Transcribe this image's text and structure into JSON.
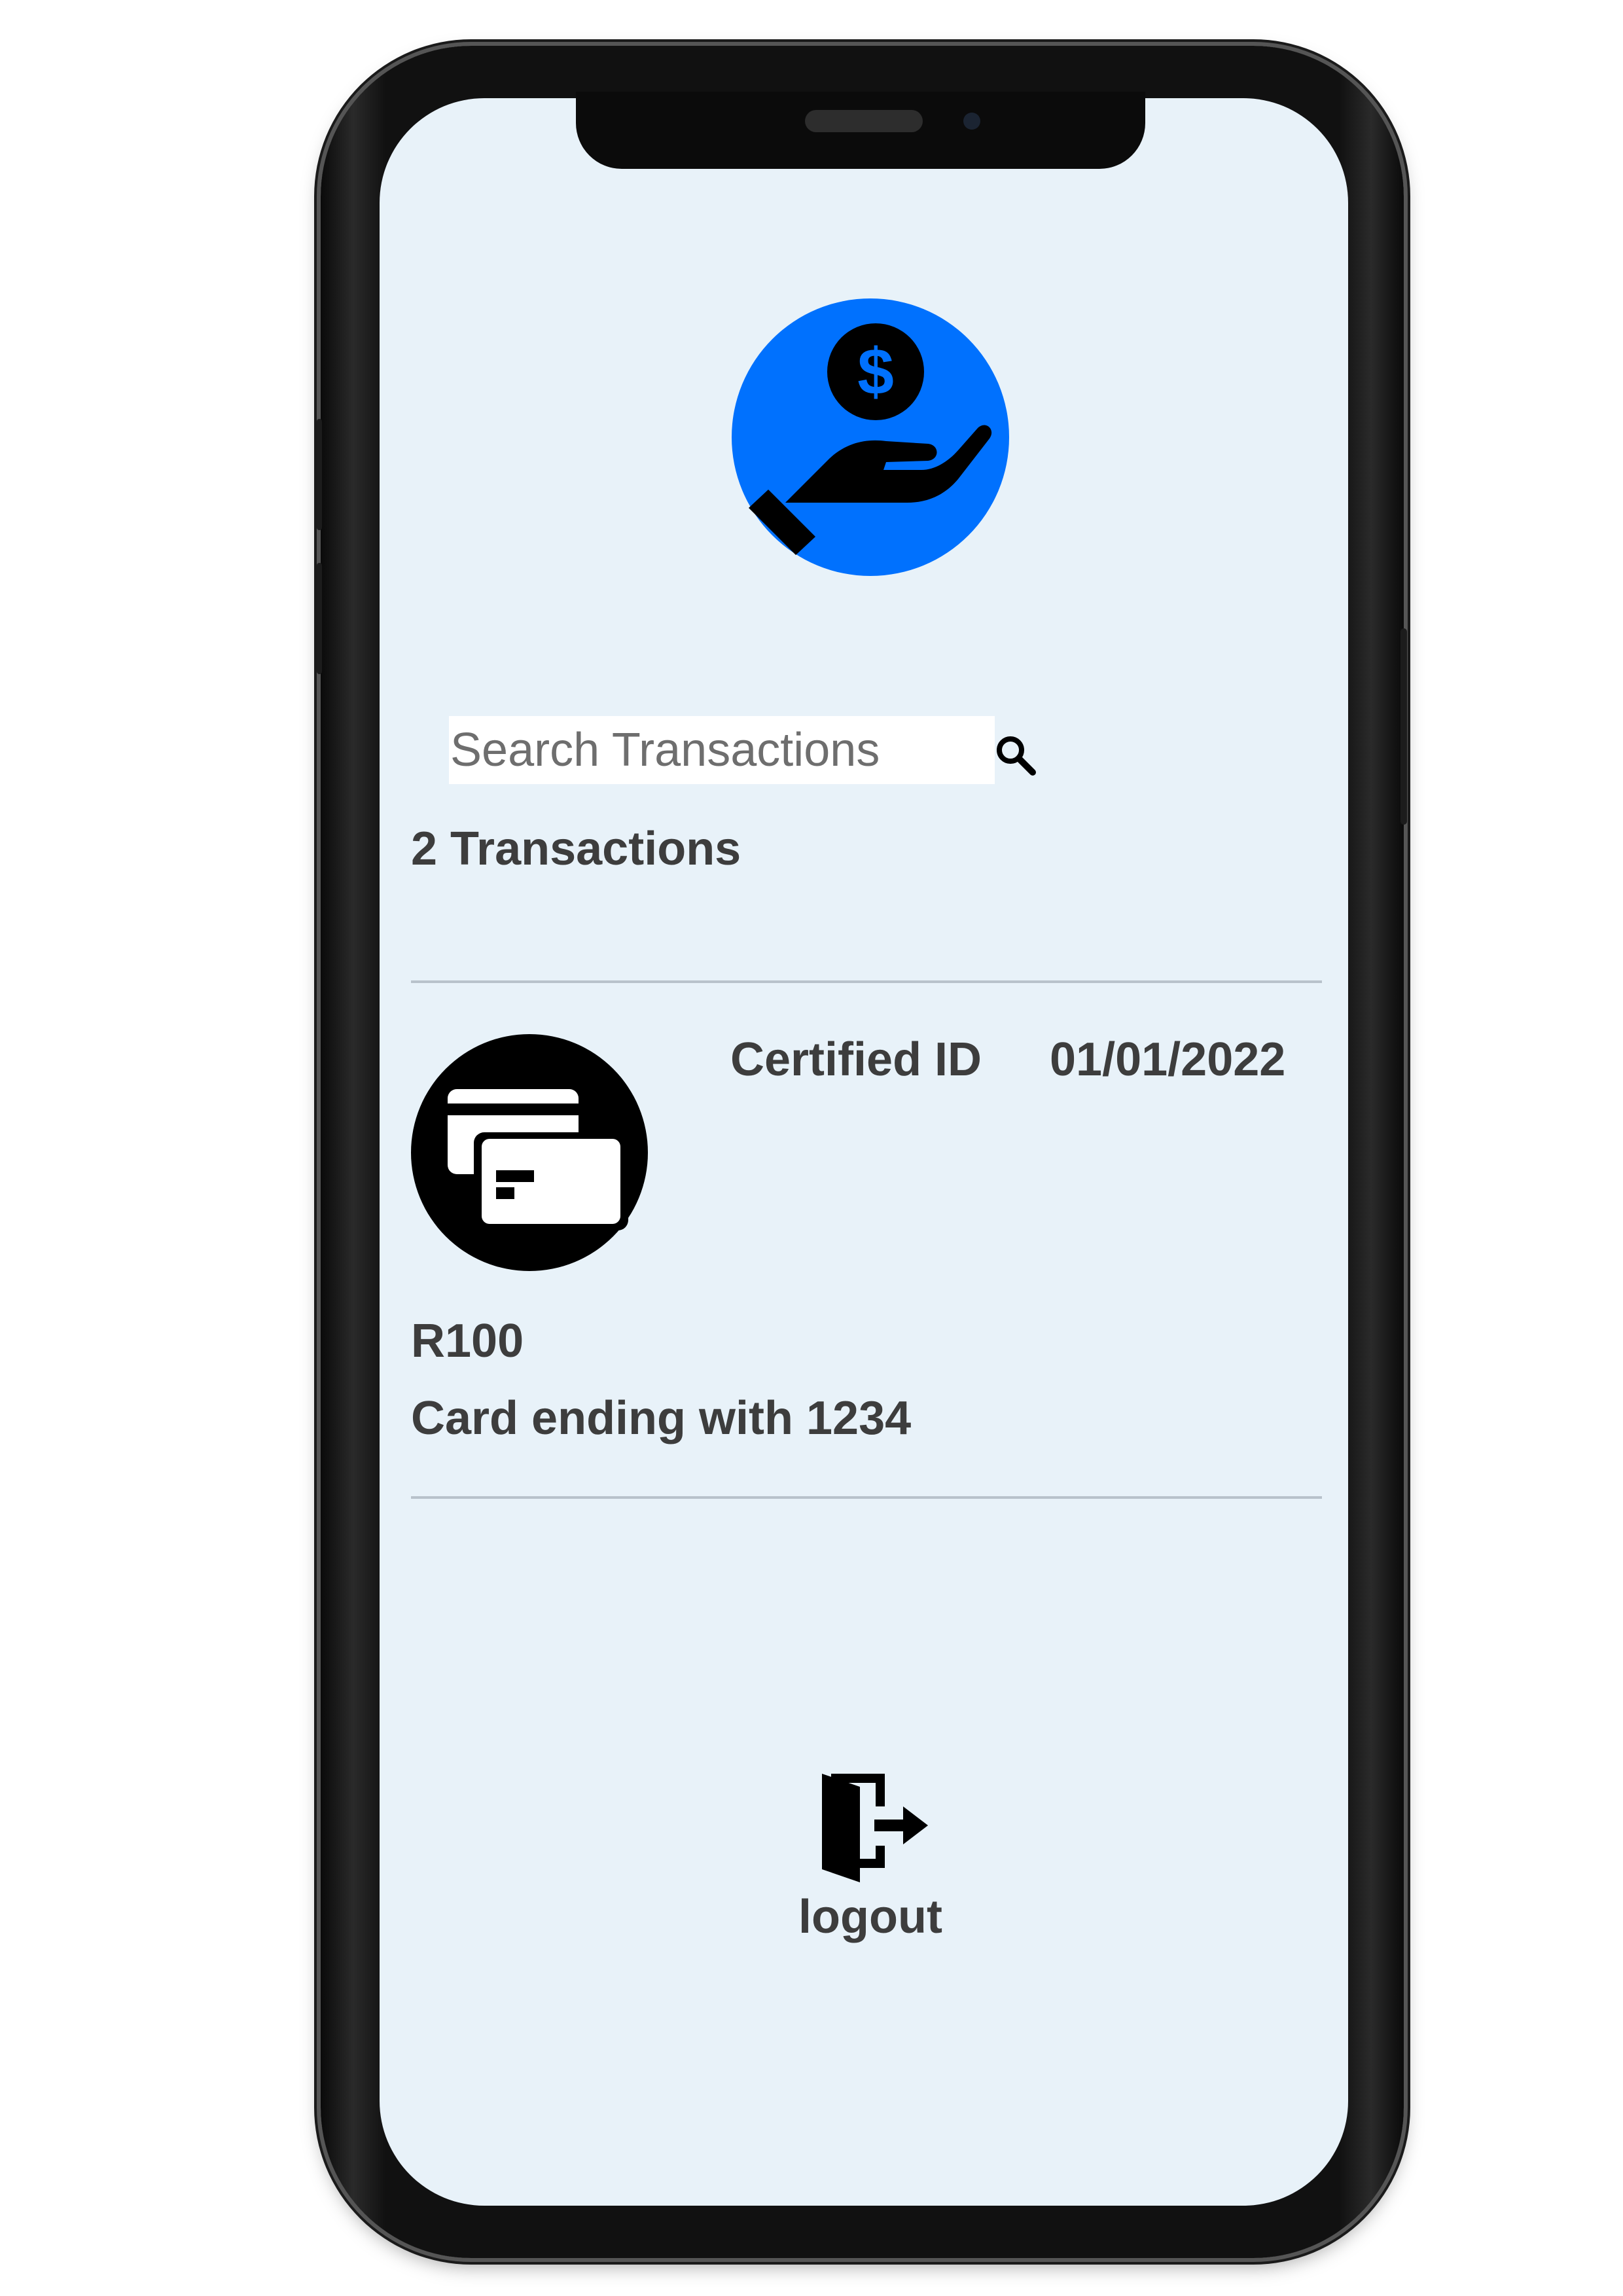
{
  "app": {
    "logo_icon": "hand-holding-dollar-icon",
    "accent_color": "#0071fe"
  },
  "search": {
    "placeholder": "Search Transactions",
    "value": "",
    "icon": "search-icon"
  },
  "transactions": {
    "count_label": "2 Transactions",
    "items": [
      {
        "icon": "credit-cards-icon",
        "title": "Certified ID",
        "date": "01/01/2022",
        "amount": "R100",
        "card": "Card ending with 1234"
      }
    ]
  },
  "footer": {
    "logout_label": "logout",
    "logout_icon": "logout-door-icon"
  }
}
